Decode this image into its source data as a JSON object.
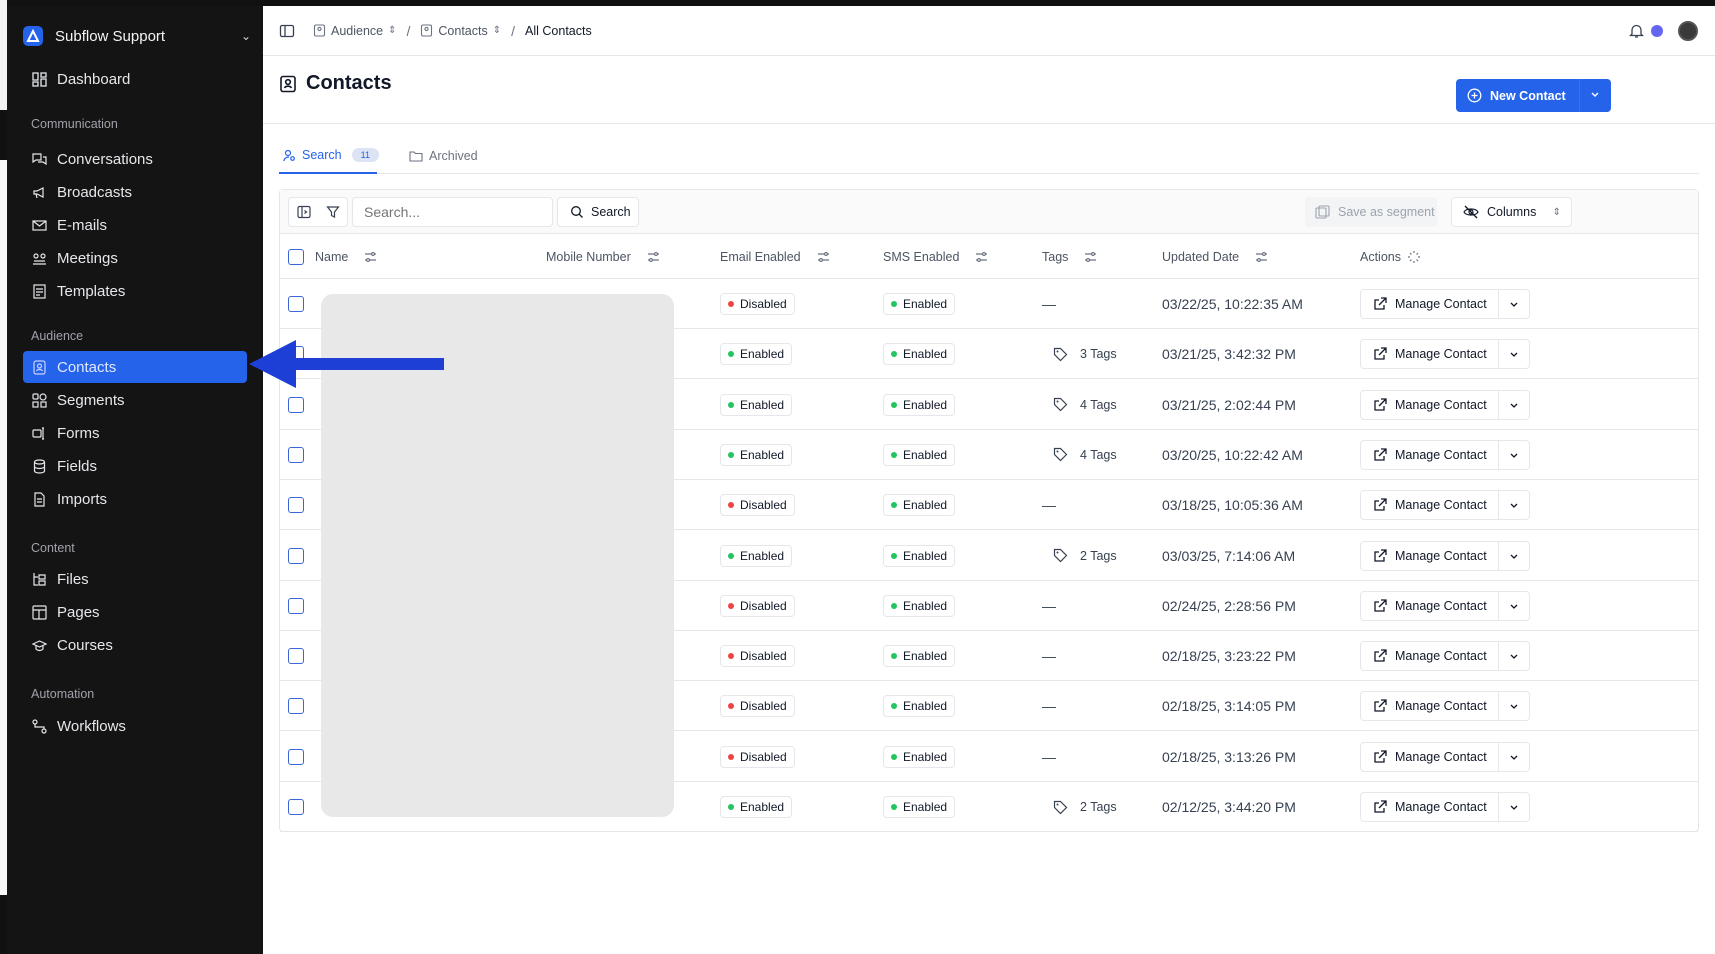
{
  "workspace": {
    "name": "Subflow Support"
  },
  "sidebar": {
    "top": [
      {
        "label": "Dashboard",
        "icon": "dashboard-icon"
      }
    ],
    "sections": [
      {
        "title": "Communication",
        "items": [
          {
            "label": "Conversations",
            "icon": "conversations-icon"
          },
          {
            "label": "Broadcasts",
            "icon": "megaphone-icon"
          },
          {
            "label": "E-mails",
            "icon": "mail-icon"
          },
          {
            "label": "Meetings",
            "icon": "meetings-icon"
          },
          {
            "label": "Templates",
            "icon": "templates-icon"
          }
        ]
      },
      {
        "title": "Audience",
        "items": [
          {
            "label": "Contacts",
            "icon": "contact-card-icon",
            "active": true
          },
          {
            "label": "Segments",
            "icon": "segments-icon"
          },
          {
            "label": "Forms",
            "icon": "forms-icon"
          },
          {
            "label": "Fields",
            "icon": "database-icon"
          },
          {
            "label": "Imports",
            "icon": "import-icon"
          }
        ]
      },
      {
        "title": "Content",
        "items": [
          {
            "label": "Files",
            "icon": "files-icon"
          },
          {
            "label": "Pages",
            "icon": "pages-icon"
          },
          {
            "label": "Courses",
            "icon": "graduation-cap-icon"
          }
        ]
      },
      {
        "title": "Automation",
        "items": [
          {
            "label": "Workflows",
            "icon": "workflow-icon"
          }
        ]
      }
    ]
  },
  "breadcrumb": [
    "Audience",
    "Contacts",
    "All Contacts"
  ],
  "page": {
    "title": "Contacts",
    "new_button": "New Contact"
  },
  "tabs": {
    "search": "Search",
    "search_count": "11",
    "archived": "Archived"
  },
  "toolbar": {
    "search_placeholder": "Search...",
    "search_button": "Search",
    "save_segment": "Save as segment",
    "columns": "Columns"
  },
  "columns": [
    "Name",
    "Mobile Number",
    "Email Enabled",
    "SMS Enabled",
    "Tags",
    "Updated Date",
    "Actions"
  ],
  "rows": [
    {
      "email": "Disabled",
      "sms": "Enabled",
      "tags": "—",
      "date": "03/22/25, 10:22:35 AM"
    },
    {
      "email": "Enabled",
      "sms": "Enabled",
      "tags": "3 Tags",
      "date": "03/21/25, 3:42:32 PM"
    },
    {
      "email": "Enabled",
      "sms": "Enabled",
      "tags": "4 Tags",
      "date": "03/21/25, 2:02:44 PM"
    },
    {
      "email": "Enabled",
      "sms": "Enabled",
      "tags": "4 Tags",
      "date": "03/20/25, 10:22:42 AM"
    },
    {
      "email": "Disabled",
      "sms": "Enabled",
      "tags": "—",
      "date": "03/18/25, 10:05:36 AM"
    },
    {
      "email": "Enabled",
      "sms": "Enabled",
      "tags": "2 Tags",
      "date": "03/03/25, 7:14:06 AM"
    },
    {
      "email": "Disabled",
      "sms": "Enabled",
      "tags": "—",
      "date": "02/24/25, 2:28:56 PM"
    },
    {
      "email": "Disabled",
      "sms": "Enabled",
      "tags": "—",
      "date": "02/18/25, 3:23:22 PM"
    },
    {
      "email": "Disabled",
      "sms": "Enabled",
      "tags": "—",
      "date": "02/18/25, 3:14:05 PM"
    },
    {
      "email": "Disabled",
      "sms": "Enabled",
      "tags": "—",
      "date": "02/18/25, 3:13:26 PM"
    },
    {
      "email": "Enabled",
      "sms": "Enabled",
      "tags": "2 Tags",
      "date": "02/12/25, 3:44:20 PM"
    }
  ],
  "manage_label": "Manage Contact",
  "colors": {
    "accent": "#2563eb",
    "enabled_dot": "#22c55e",
    "disabled_dot": "#ef4444",
    "sidebar_bg": "#141414"
  }
}
